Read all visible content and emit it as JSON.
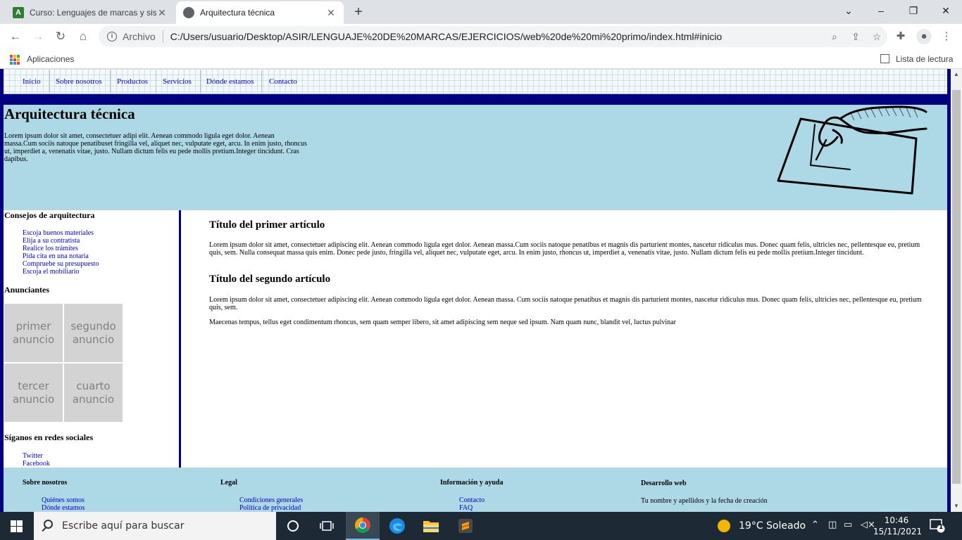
{
  "browser": {
    "tabs": [
      {
        "label": "Curso: Lenguajes de marcas y sist",
        "favicon": "A"
      },
      {
        "label": "Arquitectura técnica"
      }
    ],
    "address": {
      "scheme_label": "Archivo",
      "url": "C:/Users/usuario/Desktop/ASIR/LENGUAJE%20DE%20MARCAS/EJERCICIOS/web%20de%20mi%20primo/index.html#inicio"
    },
    "bookmarks": {
      "apps_label": "Aplicaciones",
      "reading_list_label": "Lista de lectura"
    },
    "colors": {
      "tabbar": "#dee1e6",
      "omnibox": "#f1f3f4"
    }
  },
  "page": {
    "nav": [
      "Inicio",
      "Sobre nosotros",
      "Productos",
      "Servicios",
      "Dónde estamos",
      "Contacto"
    ],
    "hero": {
      "title": "Arquitectura técnica",
      "text": "Lorem ipsum dolor sit amet, consectetuer adipi elit. Aenean commodo ligula eget dolor. Aenean massa.Cum sociis natoque penatibuset fringilla vel, aliquet nec, vulputate eget, arcu. In enim justo, rhoncus ut, imperdiet a, venenatis vitae, justo. Nullam dictum felis eu pede mollis pretium.Integer tincidunt. Cras dapibus."
    },
    "sidebar": {
      "advice_title": "Consejos de arquitectura",
      "advice_links": [
        "Escoja buenos materiales",
        "Elija a su contratista",
        "Realice los trámites",
        "Pida cita en una notaria",
        "Compruebe su presupuesto",
        "Escoja el mobiliario"
      ],
      "ads_title": "Anunciantes",
      "ads": [
        "primer anuncio",
        "segundo anuncio",
        "tercer anuncio",
        "cuarto anuncio"
      ],
      "social_title": "Síganos en redes sociales",
      "social_links": [
        "Twitter",
        "Facebook"
      ]
    },
    "articles": [
      {
        "title": "Título del primer artículo",
        "paragraphs": [
          "Lorem ipsum dolor sit amet, consectetuer adipiscing elit. Aenean commodo ligula eget dolor. Aenean massa.Cum sociis natoque penatibus et magnis dis parturient montes, nascetur ridiculus mus. Donec quam felis, ultricies nec, pellentesque eu, pretium quis, sem. Nulla consequat massa quis enim. Donec pede justo, fringilla vel, aliquet nec, vulputate eget, arcu. In enim justo, rhoncus ut, imperdiet a, venenatis vitae, justo. Nullam dictum felis eu pede mollis pretium.Integer tincidunt."
        ]
      },
      {
        "title": "Título del segundo artículo",
        "paragraphs": [
          "Lorem ipsum dolor sit amet, consectetuer adipiscing elit. Aenean commodo ligula eget dolor. Aenean massa. Cum sociis natoque penatibus et magnis dis parturient montes, nascetur ridiculus mus. Donec quam felis, ultricies nec, pellentesque eu, pretium quis, sem.",
          "Maecenas tempus, tellus eget condimentum rhoncus, sem quam semper libero, sit amet adipiscing sem neque sed ipsum. Nam quam nunc, blandit vel, luctus pulvinar"
        ]
      }
    ],
    "footer": [
      {
        "title": "Sobre nosotros",
        "links": [
          "Quiénes somos",
          "Dónde estamos"
        ]
      },
      {
        "title": "Legal",
        "links": [
          "Condiciones generales",
          "Política de privacidad"
        ]
      },
      {
        "title": "Información y ayuda",
        "links": [
          "Contacto",
          "FAQ"
        ]
      },
      {
        "title": "Desarrollo web",
        "text": "Tu nombre y apellidos y la fecha de creación"
      }
    ],
    "colors": {
      "frame": "#000080",
      "hero_bg": "#add8e6",
      "ad_bg": "#d3d3d3",
      "link": "#0000cc"
    }
  },
  "taskbar": {
    "search_placeholder": "Escribe aquí para buscar",
    "weather": "19°C  Soleado",
    "time": "10:46",
    "date": "15/11/2021",
    "notification_count": "1",
    "apps": [
      "task-view",
      "chrome",
      "edge",
      "file-explorer",
      "sublime-text"
    ]
  }
}
